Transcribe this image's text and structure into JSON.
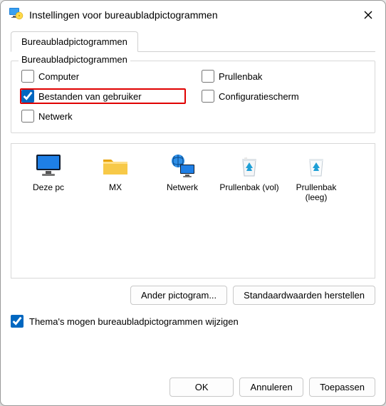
{
  "titlebar": {
    "title": "Instellingen voor bureaubladpictogrammen"
  },
  "tab": {
    "label": "Bureaubladpictogrammen"
  },
  "group": {
    "legend": "Bureaubladpictogrammen",
    "items": [
      {
        "label": "Computer",
        "checked": false
      },
      {
        "label": "Prullenbak",
        "checked": false
      },
      {
        "label": "Bestanden van gebruiker",
        "checked": true,
        "highlight": true
      },
      {
        "label": "Configuratiescherm",
        "checked": false
      },
      {
        "label": "Netwerk",
        "checked": false
      }
    ]
  },
  "preview": {
    "items": [
      {
        "label": "Deze pc",
        "icon": "monitor"
      },
      {
        "label": "MX",
        "icon": "folder"
      },
      {
        "label": "Netwerk",
        "icon": "globe-monitor"
      },
      {
        "label": "Prullenbak (vol)",
        "icon": "bin-full"
      },
      {
        "label": "Prullenbak (leeg)",
        "icon": "bin-empty"
      }
    ]
  },
  "buttons": {
    "change_icon": "Ander pictogram...",
    "restore_defaults": "Standaardwaarden herstellen"
  },
  "themes_checkbox": {
    "label": "Thema's mogen bureaubladpictogrammen wijzigen",
    "checked": true
  },
  "footer": {
    "ok": "OK",
    "cancel": "Annuleren",
    "apply": "Toepassen"
  }
}
